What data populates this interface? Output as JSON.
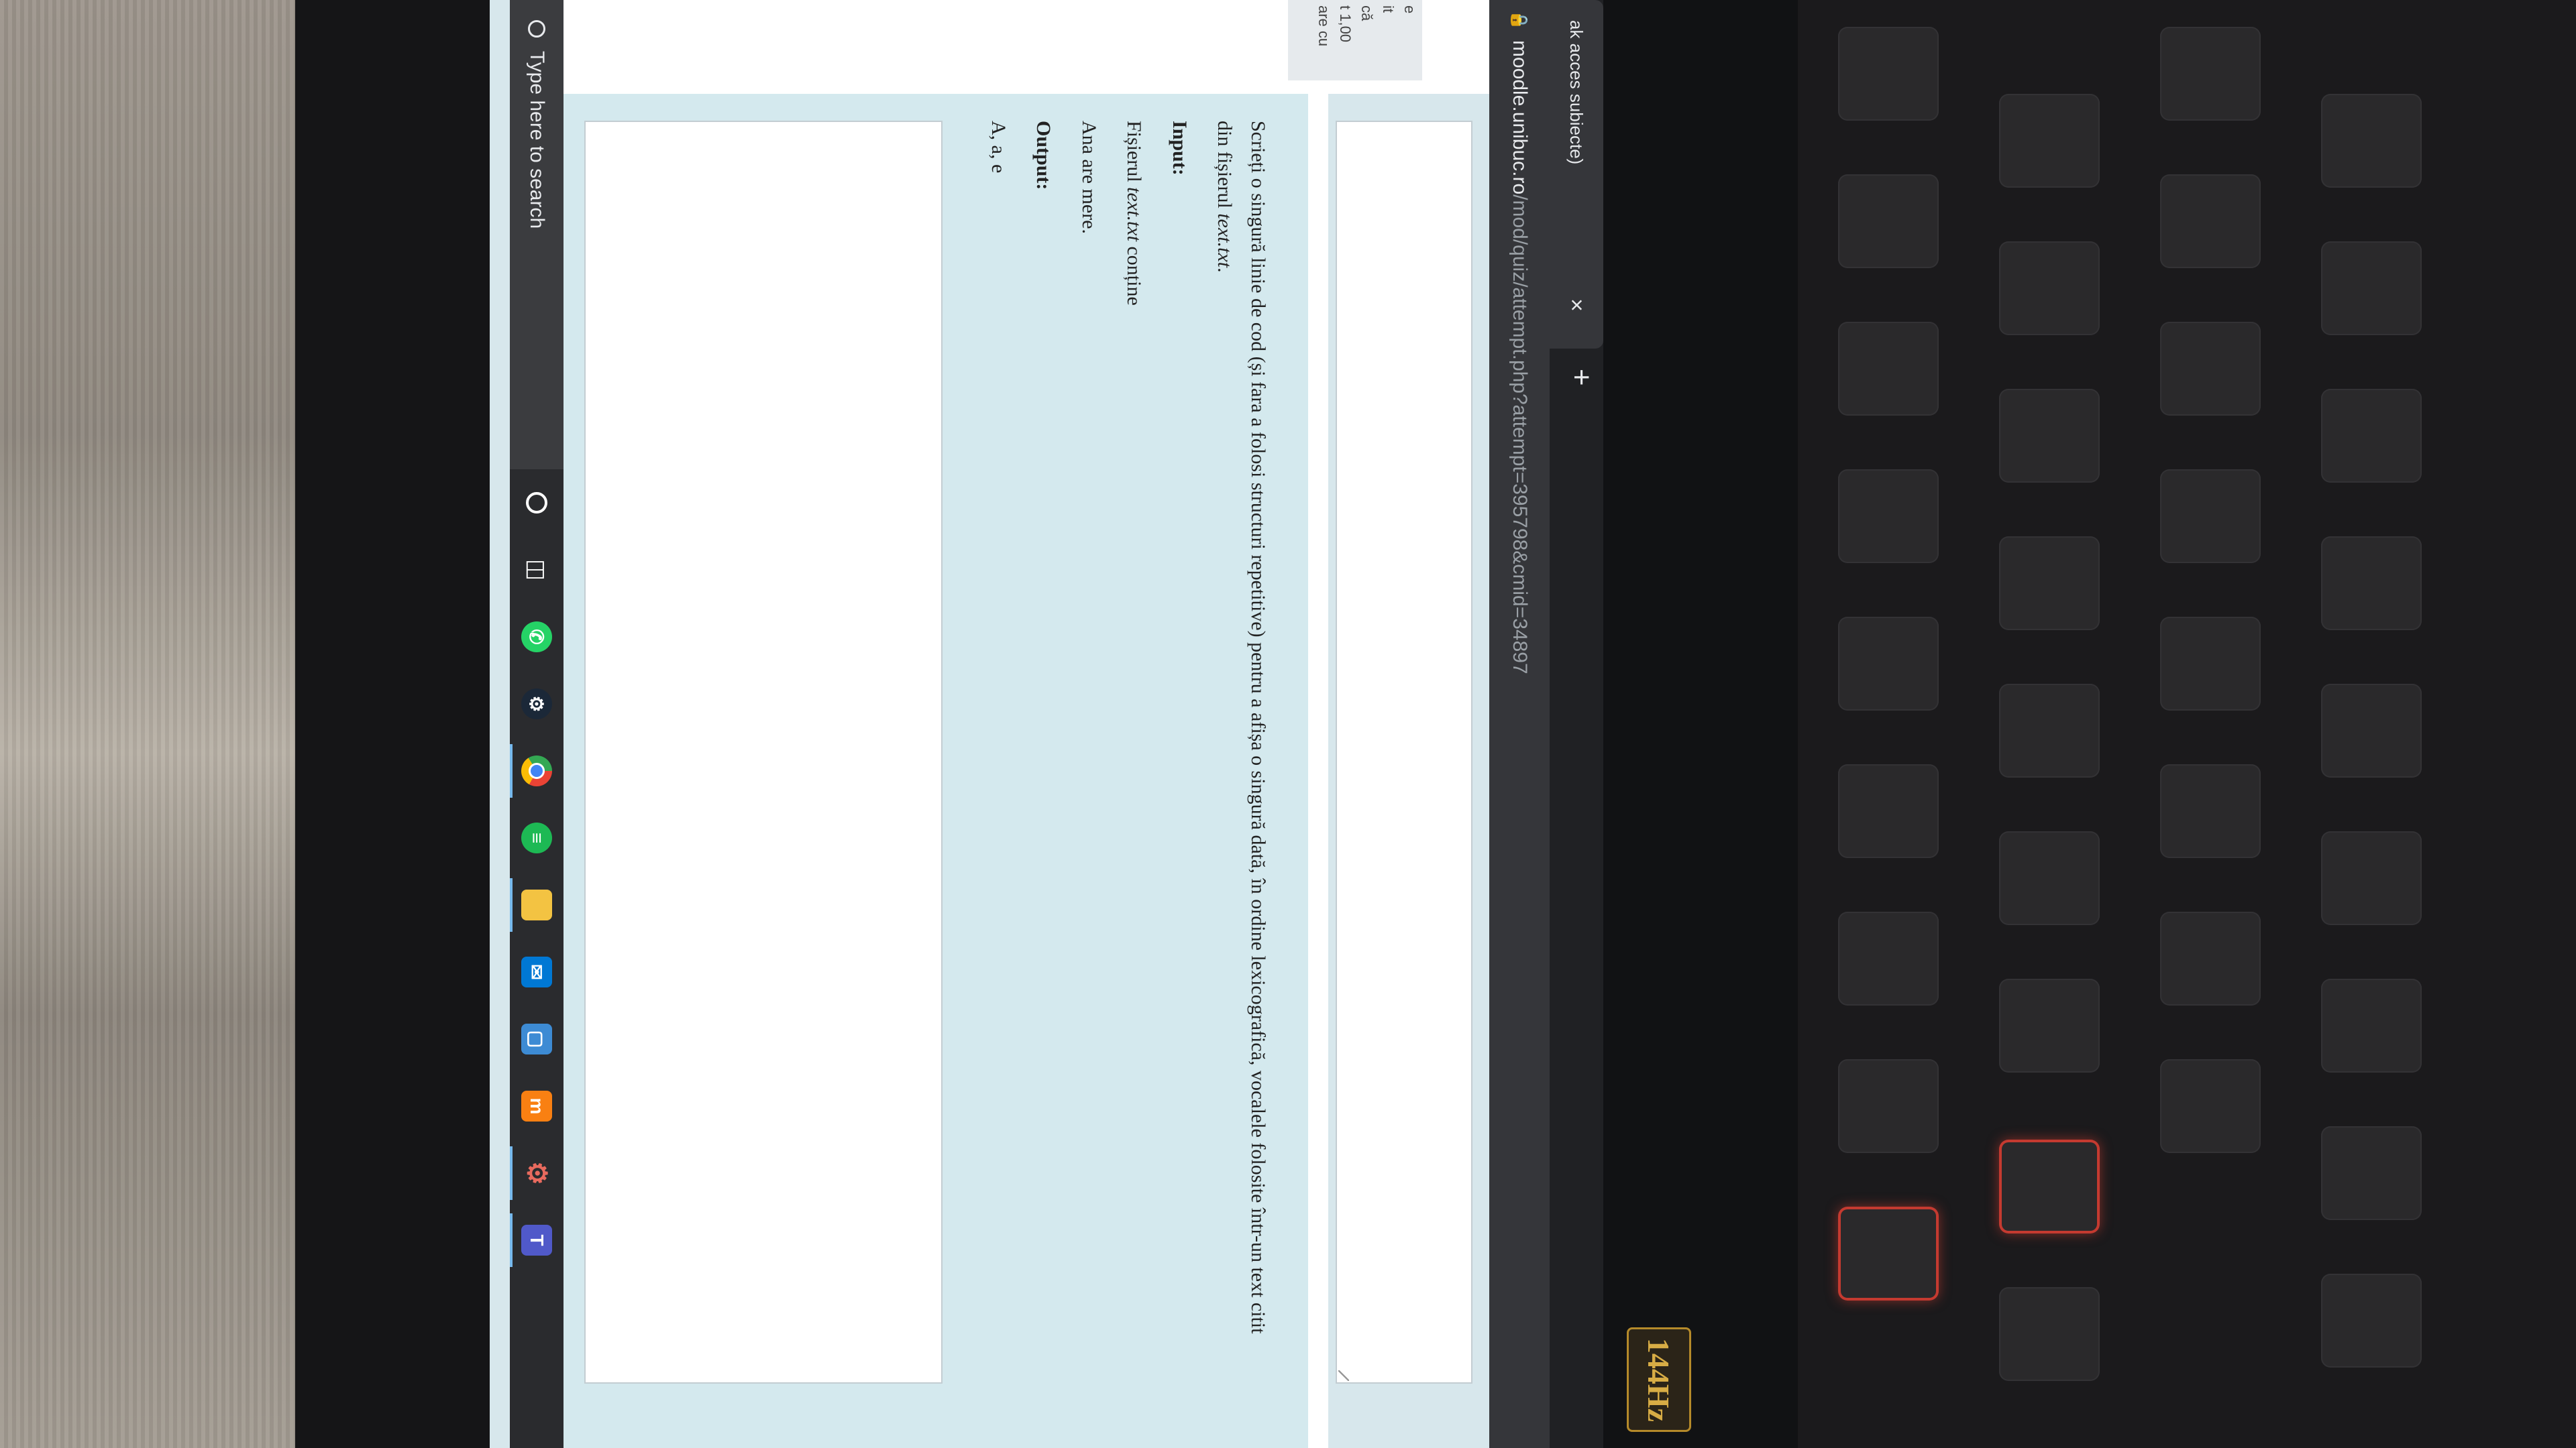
{
  "browser": {
    "tab_title": "ak acces subiecte)",
    "tab_close": "×",
    "new_tab": "+",
    "url_domain": "moodle.unibuc.ro",
    "url_path": "/mod/quiz/attempt.php?attempt=395798&cmid=34897"
  },
  "sidebar": {
    "fragments": [
      "e",
      "it",
      "că",
      "t 1,00",
      "are cu"
    ]
  },
  "question": {
    "line1": "Scrieți o singură linie de cod (și fara a folosi structuri repetitive) pentru a afișa o singură dată, în ordine lexicografică, vocalele folosite într-un text citit",
    "line2_prefix": "din fișierul ",
    "filename": "text.txt",
    "line2_suffix": ".",
    "input_label": "Input:",
    "input_prefix": "Fișierul ",
    "input_suffix": " conține",
    "input_text": "Ana are mere.",
    "output_label": "Output:",
    "output_text": "A, a, e"
  },
  "taskbar": {
    "search_placeholder": "Type here to search",
    "apps": [
      {
        "name": "cortana-icon"
      },
      {
        "name": "task-view-icon"
      },
      {
        "name": "whatsapp-icon",
        "color": "#25d366"
      },
      {
        "name": "steam-icon",
        "color": "#1b2838"
      },
      {
        "name": "chrome-icon",
        "color": "#4285f4"
      },
      {
        "name": "spotify-icon",
        "color": "#1db954"
      },
      {
        "name": "file-explorer-icon",
        "color": "#f3c342"
      },
      {
        "name": "mail-icon",
        "color": "#0078d4"
      },
      {
        "name": "codeblocks-icon",
        "color": "#3d8bd4"
      },
      {
        "name": "moodle-icon",
        "color": "#f98012"
      },
      {
        "name": "settings-gear-icon",
        "color": "#c0392b"
      },
      {
        "name": "teams-icon",
        "color": "#5059c9"
      }
    ]
  },
  "sticker": {
    "text": "144Hz"
  }
}
